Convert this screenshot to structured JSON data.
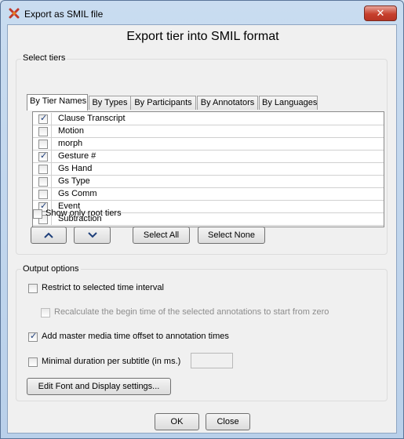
{
  "window": {
    "title": "Export as SMIL file",
    "close_symbol": "✕"
  },
  "dialog": {
    "heading": "Export tier into SMIL format"
  },
  "select_tiers": {
    "legend": "Select tiers",
    "tabs": [
      {
        "label": "By Tier Names",
        "active": true
      },
      {
        "label": "By Types",
        "active": false
      },
      {
        "label": "By Participants",
        "active": false
      },
      {
        "label": "By Annotators",
        "active": false
      },
      {
        "label": "By Languages",
        "active": false
      }
    ],
    "tiers": [
      {
        "name": "Clause Transcript",
        "checked": true
      },
      {
        "name": "Motion",
        "checked": false
      },
      {
        "name": "morph",
        "checked": false
      },
      {
        "name": "Gesture #",
        "checked": true
      },
      {
        "name": "Gs Hand",
        "checked": false
      },
      {
        "name": "Gs Type",
        "checked": false
      },
      {
        "name": "Gs Comm",
        "checked": false
      },
      {
        "name": "Event",
        "checked": true
      },
      {
        "name": "Subtraction",
        "checked": false
      }
    ],
    "show_only_root_label": "Show only root tiers",
    "move_up_icon": "chevron-up-icon",
    "move_down_icon": "chevron-down-icon",
    "select_all_label": "Select All",
    "select_none_label": "Select None"
  },
  "output_options": {
    "legend": "Output options",
    "restrict_label": "Restrict to selected time interval",
    "recalculate_label": "Recalculate the begin time of the selected annotations to start from zero",
    "add_offset_label": "Add master media time offset to annotation times",
    "add_offset_checked": true,
    "min_duration_label": "Minimal duration per subtitle (in ms.)",
    "min_duration_value": "",
    "edit_font_label": "Edit Font and Display settings..."
  },
  "footer": {
    "ok_label": "OK",
    "close_label": "Close"
  },
  "colors": {
    "checkmark": "#1c3c7a",
    "title_close": "#c7402d"
  }
}
